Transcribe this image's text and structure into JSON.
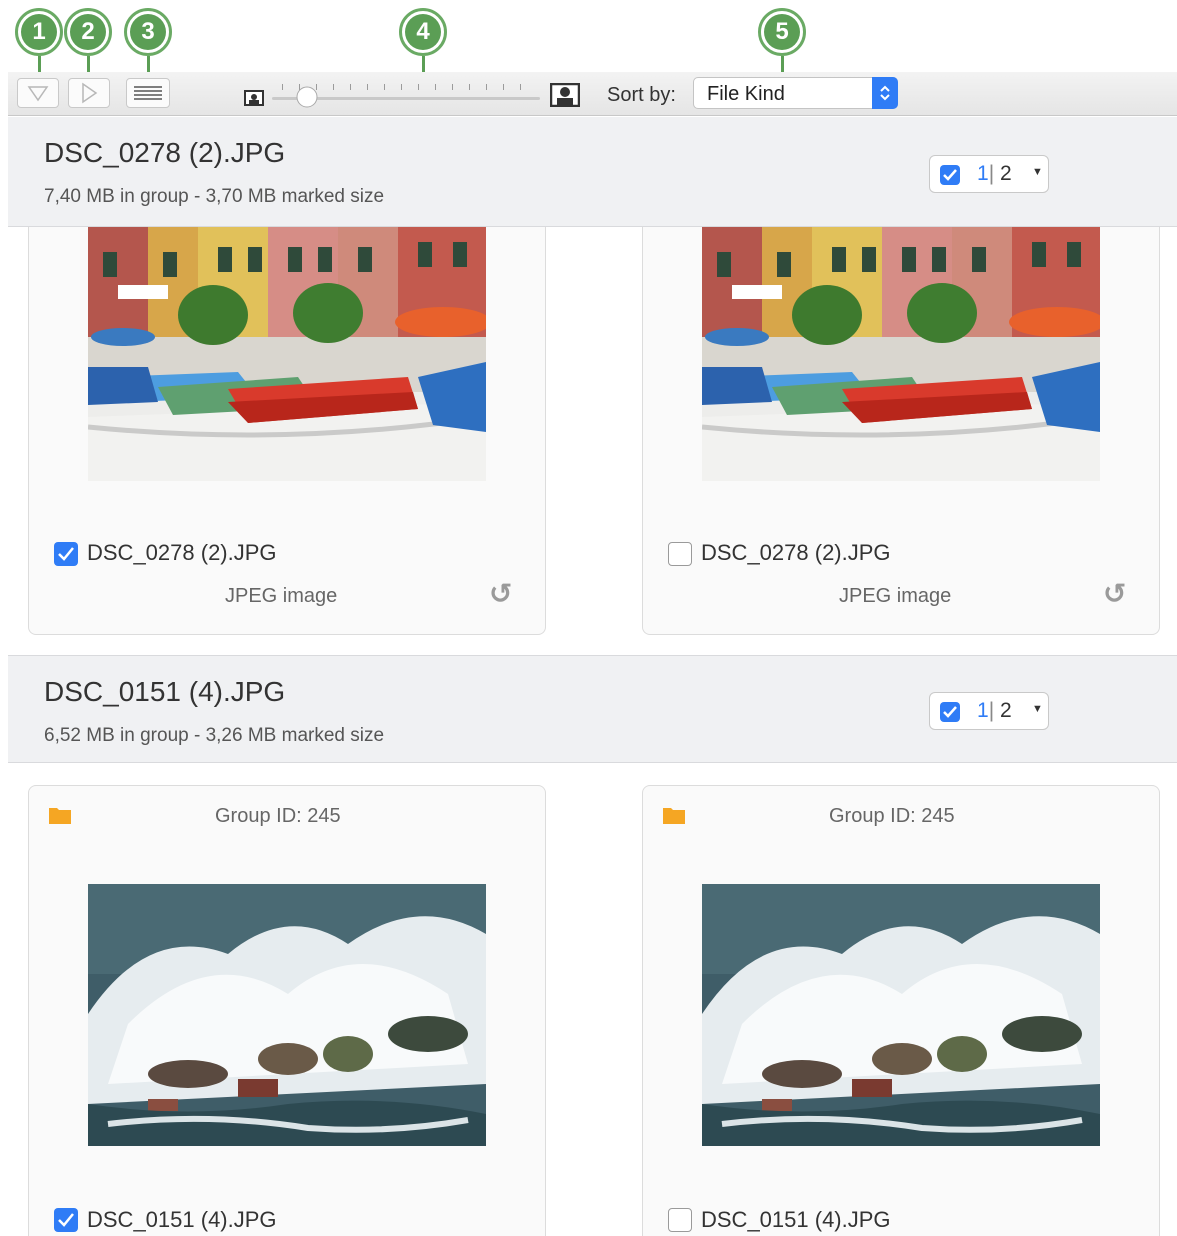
{
  "callouts": [
    "1",
    "2",
    "3",
    "4",
    "5"
  ],
  "toolbar": {
    "sort_label": "Sort by:",
    "sort_value": "File Kind"
  },
  "groups": [
    {
      "title": "DSC_0278 (2).JPG",
      "subtitle": "7,40 MB in group - 3,70 MB marked size",
      "counter": {
        "selected": "1",
        "separator": "|",
        "total": "2"
      },
      "items": [
        {
          "filename": "DSC_0278 (2).JPG",
          "checked": true,
          "kind": "JPEG image"
        },
        {
          "filename": "DSC_0278 (2).JPG",
          "checked": false,
          "kind": "JPEG image"
        }
      ]
    },
    {
      "title": "DSC_0151 (4).JPG",
      "subtitle": "6,52 MB in group - 3,26 MB marked size",
      "counter": {
        "selected": "1",
        "separator": "|",
        "total": "2"
      },
      "items": [
        {
          "filename": "DSC_0151 (4).JPG",
          "checked": true,
          "group_id": "Group ID: 245"
        },
        {
          "filename": "DSC_0151 (4).JPG",
          "checked": false,
          "group_id": "Group ID: 245"
        }
      ]
    }
  ],
  "colors": {
    "accent": "#2f7cf6",
    "callout": "#5b9e55",
    "folder": "#f5a623"
  }
}
